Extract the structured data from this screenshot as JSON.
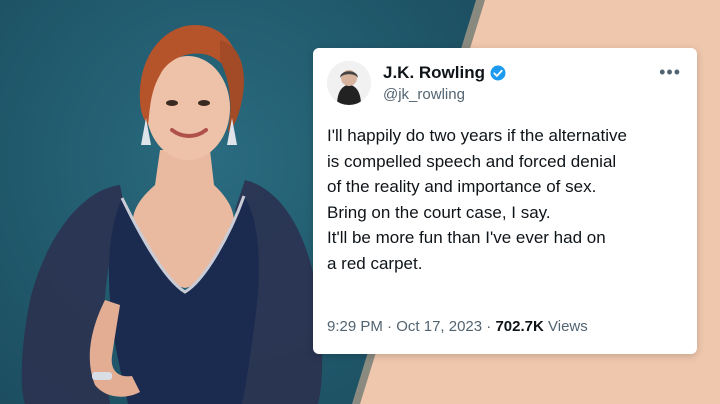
{
  "tweet": {
    "author_name": "J.K. Rowling",
    "handle": "@jk_rowling",
    "more_icon": "more-horizontal-icon",
    "verified_icon": "verified-badge-icon",
    "verified_color": "#1d9bf0",
    "text_lines": [
      "I'll happily do two years if the alternative",
      "is compelled speech and forced denial",
      "of the reality and importance of sex.",
      "Bring on the court case, I say.",
      "It'll be more fun than I've ever had on",
      "a red carpet."
    ],
    "time": "9:29 PM",
    "date": "Oct 17, 2023",
    "views_count": "702.7K",
    "views_label": "Views"
  },
  "colors": {
    "background_teal": "#1f5566",
    "background_peach": "#efc7ad",
    "dress": "#1b2a4f"
  }
}
